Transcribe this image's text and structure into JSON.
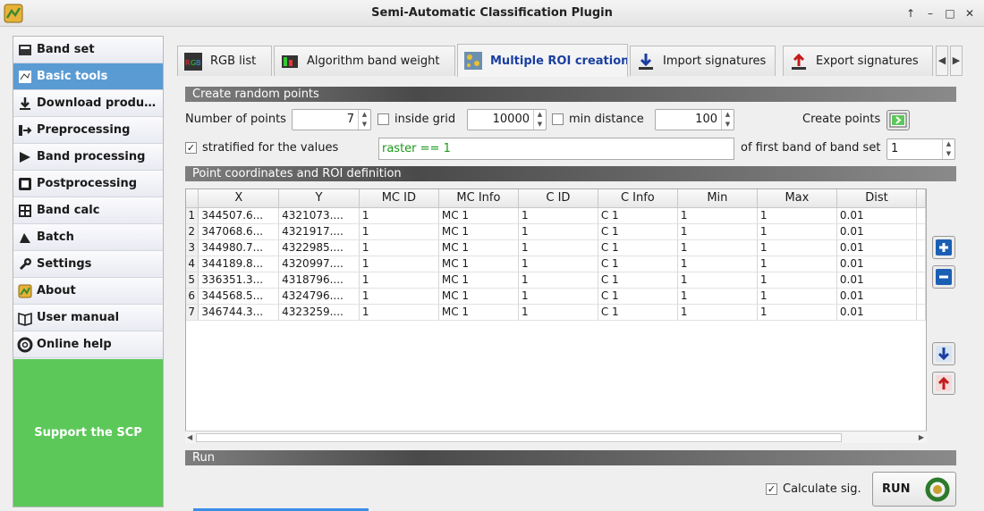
{
  "window": {
    "title": "Semi-Automatic Classification Plugin",
    "buttons": [
      "↑",
      "–",
      "□",
      "✕"
    ]
  },
  "sidebar": {
    "items": [
      {
        "label": "Band set"
      },
      {
        "label": "Basic tools"
      },
      {
        "label": "Download produ…"
      },
      {
        "label": "Preprocessing"
      },
      {
        "label": "Band processing"
      },
      {
        "label": "Postprocessing"
      },
      {
        "label": "Band calc"
      },
      {
        "label": "Batch"
      },
      {
        "label": "Settings"
      },
      {
        "label": "About"
      },
      {
        "label": "User manual"
      },
      {
        "label": "Online help"
      }
    ],
    "active_index": 1,
    "support_label": "Support the SCP"
  },
  "tabs": [
    {
      "label": "RGB list"
    },
    {
      "label": "Algorithm band weight"
    },
    {
      "label": "Multiple ROI creation"
    },
    {
      "label": "Import signatures"
    },
    {
      "label": "Export signatures"
    }
  ],
  "random_points": {
    "header": "Create random points",
    "num_points_label": "Number of points",
    "num_points_value": "7",
    "inside_grid_label": "inside grid",
    "inside_grid_checked": false,
    "grid_value": "10000",
    "min_distance_label": "min distance",
    "min_distance_checked": false,
    "min_distance_value": "100",
    "create_points_label": "Create points",
    "stratified_label": "stratified for the values",
    "stratified_checked": true,
    "expression": "raster == 1",
    "first_band_label": "of first band of band set",
    "band_set_value": "1"
  },
  "roi": {
    "header": "Point coordinates and ROI definition",
    "columns": [
      "X",
      "Y",
      "MC ID",
      "MC Info",
      "C ID",
      "C Info",
      "Min",
      "Max",
      "Dist"
    ],
    "rows": [
      [
        "1",
        "344507.6...",
        "4321073....",
        "1",
        "MC 1",
        "1",
        "C 1",
        "1",
        "1",
        "0.01"
      ],
      [
        "2",
        "347068.6...",
        "4321917....",
        "1",
        "MC 1",
        "1",
        "C 1",
        "1",
        "1",
        "0.01"
      ],
      [
        "3",
        "344980.7...",
        "4322985....",
        "1",
        "MC 1",
        "1",
        "C 1",
        "1",
        "1",
        "0.01"
      ],
      [
        "4",
        "344189.8...",
        "4320997....",
        "1",
        "MC 1",
        "1",
        "C 1",
        "1",
        "1",
        "0.01"
      ],
      [
        "5",
        "336351.3...",
        "4318796....",
        "1",
        "MC 1",
        "1",
        "C 1",
        "1",
        "1",
        "0.01"
      ],
      [
        "6",
        "344568.5...",
        "4324796....",
        "1",
        "MC 1",
        "1",
        "C 1",
        "1",
        "1",
        "0.01"
      ],
      [
        "7",
        "346744.3...",
        "4323259....",
        "1",
        "MC 1",
        "1",
        "C 1",
        "1",
        "1",
        "0.01"
      ]
    ]
  },
  "run": {
    "header": "Run",
    "calc_sig_label": "Calculate sig.",
    "calc_sig_checked": true,
    "run_label": "RUN"
  },
  "colors": {
    "accent": "#5a9bd4",
    "support": "#5dc85a",
    "expression": "#1a9a1a"
  }
}
